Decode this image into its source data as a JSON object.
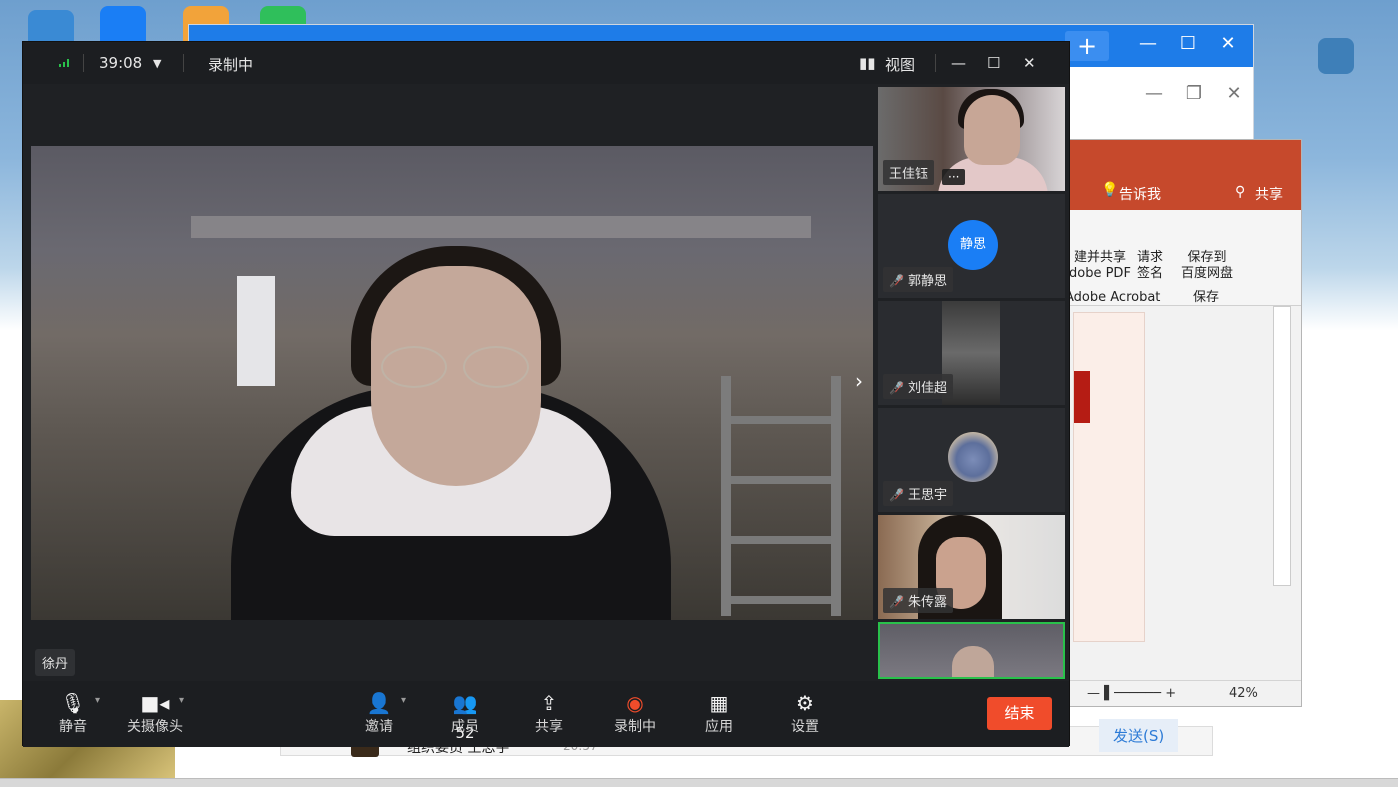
{
  "meeting": {
    "elapsed_time": "39:08",
    "recording_status": "录制中",
    "view_label": "视图",
    "speaker_name": "徐丹",
    "participants": [
      {
        "name": "王佳钰",
        "initials": "",
        "more": "···"
      },
      {
        "name": "郭静思",
        "initials": "静思"
      },
      {
        "name": "刘佳超",
        "initials": ""
      },
      {
        "name": "王思宇",
        "initials": ""
      },
      {
        "name": "朱传露",
        "initials": ""
      }
    ],
    "toolbar": {
      "mute": "静音",
      "camera": "关摄像头",
      "invite": "邀请",
      "members": "成员",
      "member_count": "52",
      "share": "共享",
      "recording": "录制中",
      "apps": "应用",
      "settings": "设置",
      "end": "结束"
    }
  },
  "word": {
    "tell_me": "告诉我",
    "share": "共享",
    "ribbon": {
      "create_share_pdf": "建并共享\ndobe PDF",
      "request_sign": "请求\n签名",
      "save_baidu": "保存到\n百度网盘",
      "group_acrobat": "Adobe Acrobat",
      "group_save": "保存"
    },
    "zoom": "42%"
  },
  "chat": {
    "name": "组织委员 王思宇",
    "time": "20:57",
    "send": "发送(S)"
  },
  "colors": {
    "end_button": "#f04c2b",
    "active_border": "#29c14b",
    "avatar_blue": "#1a7ef5",
    "word_red": "#c6492c",
    "browser_blue": "#1e7ce8"
  }
}
